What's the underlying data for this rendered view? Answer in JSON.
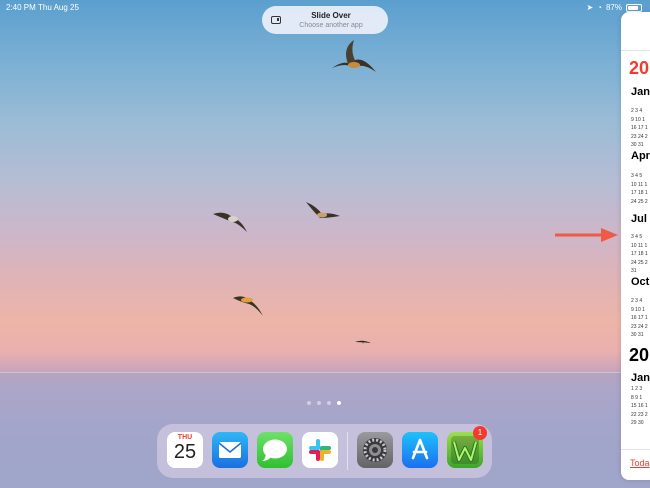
{
  "status_bar": {
    "time": "2:40 PM",
    "date": "Thu Aug 25",
    "battery": "87%",
    "battery_level": 0.87,
    "icons": [
      "location-icon",
      "wifi-icon",
      "battery-icon"
    ]
  },
  "slide_over": {
    "title": "Slide Over",
    "subtitle": "Choose another app"
  },
  "calendar_panel": {
    "year_current": "20",
    "year_next": "20",
    "months": [
      "Jan",
      "Apr",
      "Jul",
      "Oct",
      "Jan"
    ],
    "grids": [
      "2 3 4\n9 10 1\n16 17 1\n23 24 2\n30 31",
      "3 4 5\n10 11 1\n17 18 1\n24 25 2",
      "3 4 5\n10 11 1\n17 18 1\n24 25 2\n31",
      "2 3 4\n9 10 1\n16 17 1\n23 24 2\n30 31",
      "1 2 3\n8 9 1\n15 16 1\n22 23 2\n29 30"
    ],
    "today_link": "Toda"
  },
  "page_dots": {
    "count": 4,
    "active_index": 3
  },
  "dock": {
    "apps": [
      {
        "name": "Calendar",
        "day": "THU",
        "date": "25"
      },
      {
        "name": "Mail"
      },
      {
        "name": "Messages"
      },
      {
        "name": "Slack"
      },
      {
        "name": "Settings"
      },
      {
        "name": "App Store"
      },
      {
        "name": "Word game",
        "badge": "1"
      }
    ]
  },
  "colors": {
    "accent_red": "#f23b30",
    "arrow": "#ef5a45"
  }
}
